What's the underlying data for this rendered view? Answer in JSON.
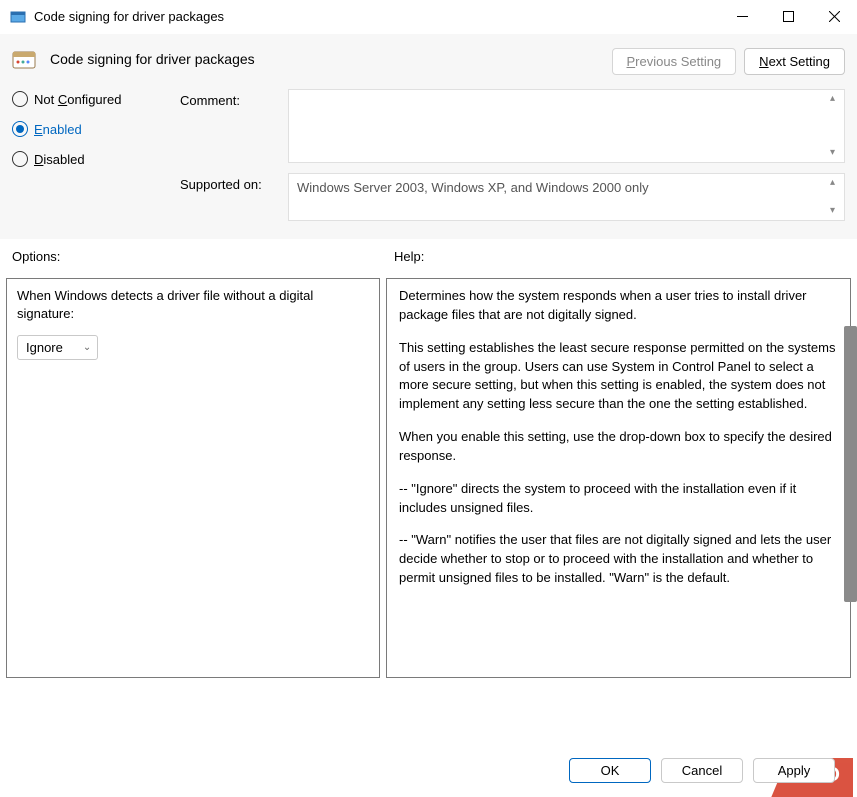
{
  "window": {
    "title": "Code signing for driver packages"
  },
  "header": {
    "policy_title": "Code signing for driver packages",
    "prev_button": "Previous Setting",
    "prev_prefix": "P",
    "prev_suffix": "revious Setting",
    "next_button": "Next Setting",
    "next_prefix": "N",
    "next_suffix": "ext Setting"
  },
  "config": {
    "comment_label": "Comment:",
    "supported_label": "Supported on:",
    "supported_text": "Windows Server 2003, Windows XP, and Windows 2000 only",
    "radios": {
      "not_configured": {
        "prefix": "Not ",
        "letter": "C",
        "suffix": "onfigured"
      },
      "enabled": {
        "prefix": "",
        "letter": "E",
        "suffix": "nabled"
      },
      "disabled": {
        "prefix": "",
        "letter": "D",
        "suffix": "isabled"
      }
    },
    "selected": "enabled"
  },
  "sections": {
    "options_label": "Options:",
    "help_label": "Help:"
  },
  "options": {
    "prompt": "When Windows detects a driver file without a digital signature:",
    "dropdown_value": "Ignore"
  },
  "help": {
    "p1": "Determines how the system responds when a user tries to install driver package files that are not digitally signed.",
    "p2": "This setting establishes the least secure response permitted on the systems of users in the group. Users can use System in Control Panel to select a more secure setting, but when this setting is enabled, the system does not implement any setting less secure than the one the setting established.",
    "p3": "When you enable this setting, use the drop-down box to specify the desired response.",
    "p4": "--   \"Ignore\" directs the system to proceed with the installation even if it includes unsigned files.",
    "p5": "--   \"Warn\" notifies the user that files are not digitally signed and lets the user decide whether to stop or to proceed with the installation and whether to permit unsigned files to be installed. \"Warn\" is the default."
  },
  "footer": {
    "ok": "OK",
    "cancel": "Cancel",
    "apply": "Apply"
  },
  "watermark": "MUO"
}
